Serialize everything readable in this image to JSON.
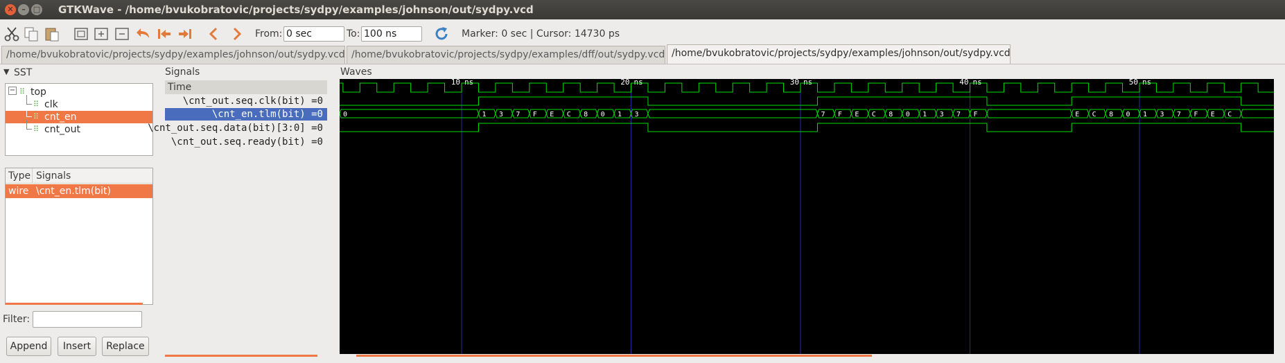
{
  "window": {
    "title": "GTKWave - /home/bvukobratovic/projects/sydpy/examples/johnson/out/sydpy.vcd"
  },
  "toolbar": {
    "from_label": "From:",
    "from_value": "0 sec",
    "to_label": "To:",
    "to_value": "100 ns",
    "marker_text": "Marker: 0 sec  |  Cursor: 14730 ps",
    "icons": [
      "cut-icon",
      "copy-icon",
      "paste-icon",
      "zoom-fit-icon",
      "zoom-in-icon",
      "zoom-out-icon",
      "undo-icon",
      "go-to-start-icon",
      "go-to-end-icon",
      "previous-icon",
      "next-icon",
      "reload-icon"
    ]
  },
  "tabs": [
    {
      "label": "/home/bvukobratovic/projects/sydpy/examples/johnson/out/sydpy.vcd",
      "active": false
    },
    {
      "label": "/home/bvukobratovic/projects/sydpy/examples/dff/out/sydpy.vcd",
      "active": false
    },
    {
      "label": "/home/bvukobratovic/projects/sydpy/examples/johnson/out/sydpy.vcd",
      "active": true
    }
  ],
  "sst": {
    "label": "SST",
    "tree": [
      {
        "label": "top",
        "selected": false
      },
      {
        "label": "clk",
        "selected": false
      },
      {
        "label": "cnt_en",
        "selected": true
      },
      {
        "label": "cnt_out",
        "selected": false
      }
    ],
    "table_headers": {
      "type": "Type",
      "signals": "Signals"
    },
    "rows": [
      {
        "type": "wire",
        "signal": "\\cnt_en.tlm(bit)"
      }
    ],
    "filter_label": "Filter:",
    "filter_value": "",
    "buttons": {
      "append": "Append",
      "insert": "Insert",
      "replace": "Replace"
    }
  },
  "signals_pane": {
    "label": "Signals",
    "time_header": "Time",
    "items": [
      {
        "name": "\\cnt_out.seq.clk(bit) =0",
        "selected": false
      },
      {
        "name": "\\cnt_en.tlm(bit) =0",
        "selected": true
      },
      {
        "name": "\\cnt_out.seq.data(bit)[3:0] =0",
        "selected": false
      },
      {
        "name": "\\cnt_out.seq.ready(bit) =0",
        "selected": false
      }
    ]
  },
  "waves": {
    "label": "Waves",
    "time_labels": [
      "10 ns",
      "20 ns",
      "30 ns",
      "40 ns",
      "50 ns"
    ],
    "colors": {
      "background": "#000000",
      "trace": "#00e000",
      "grid": "#2a2aa0",
      "text": "#ffffff"
    },
    "data_bus_values": [
      "0",
      "1",
      "3",
      "7",
      "F",
      "E",
      "C",
      "8",
      "0",
      "1",
      "3",
      "7",
      "F",
      "E",
      "C",
      "8",
      "0",
      "1",
      "3",
      "7",
      "F",
      "E",
      "C",
      "8",
      "0",
      "1",
      "3",
      "7",
      "F",
      "E",
      "C"
    ]
  }
}
